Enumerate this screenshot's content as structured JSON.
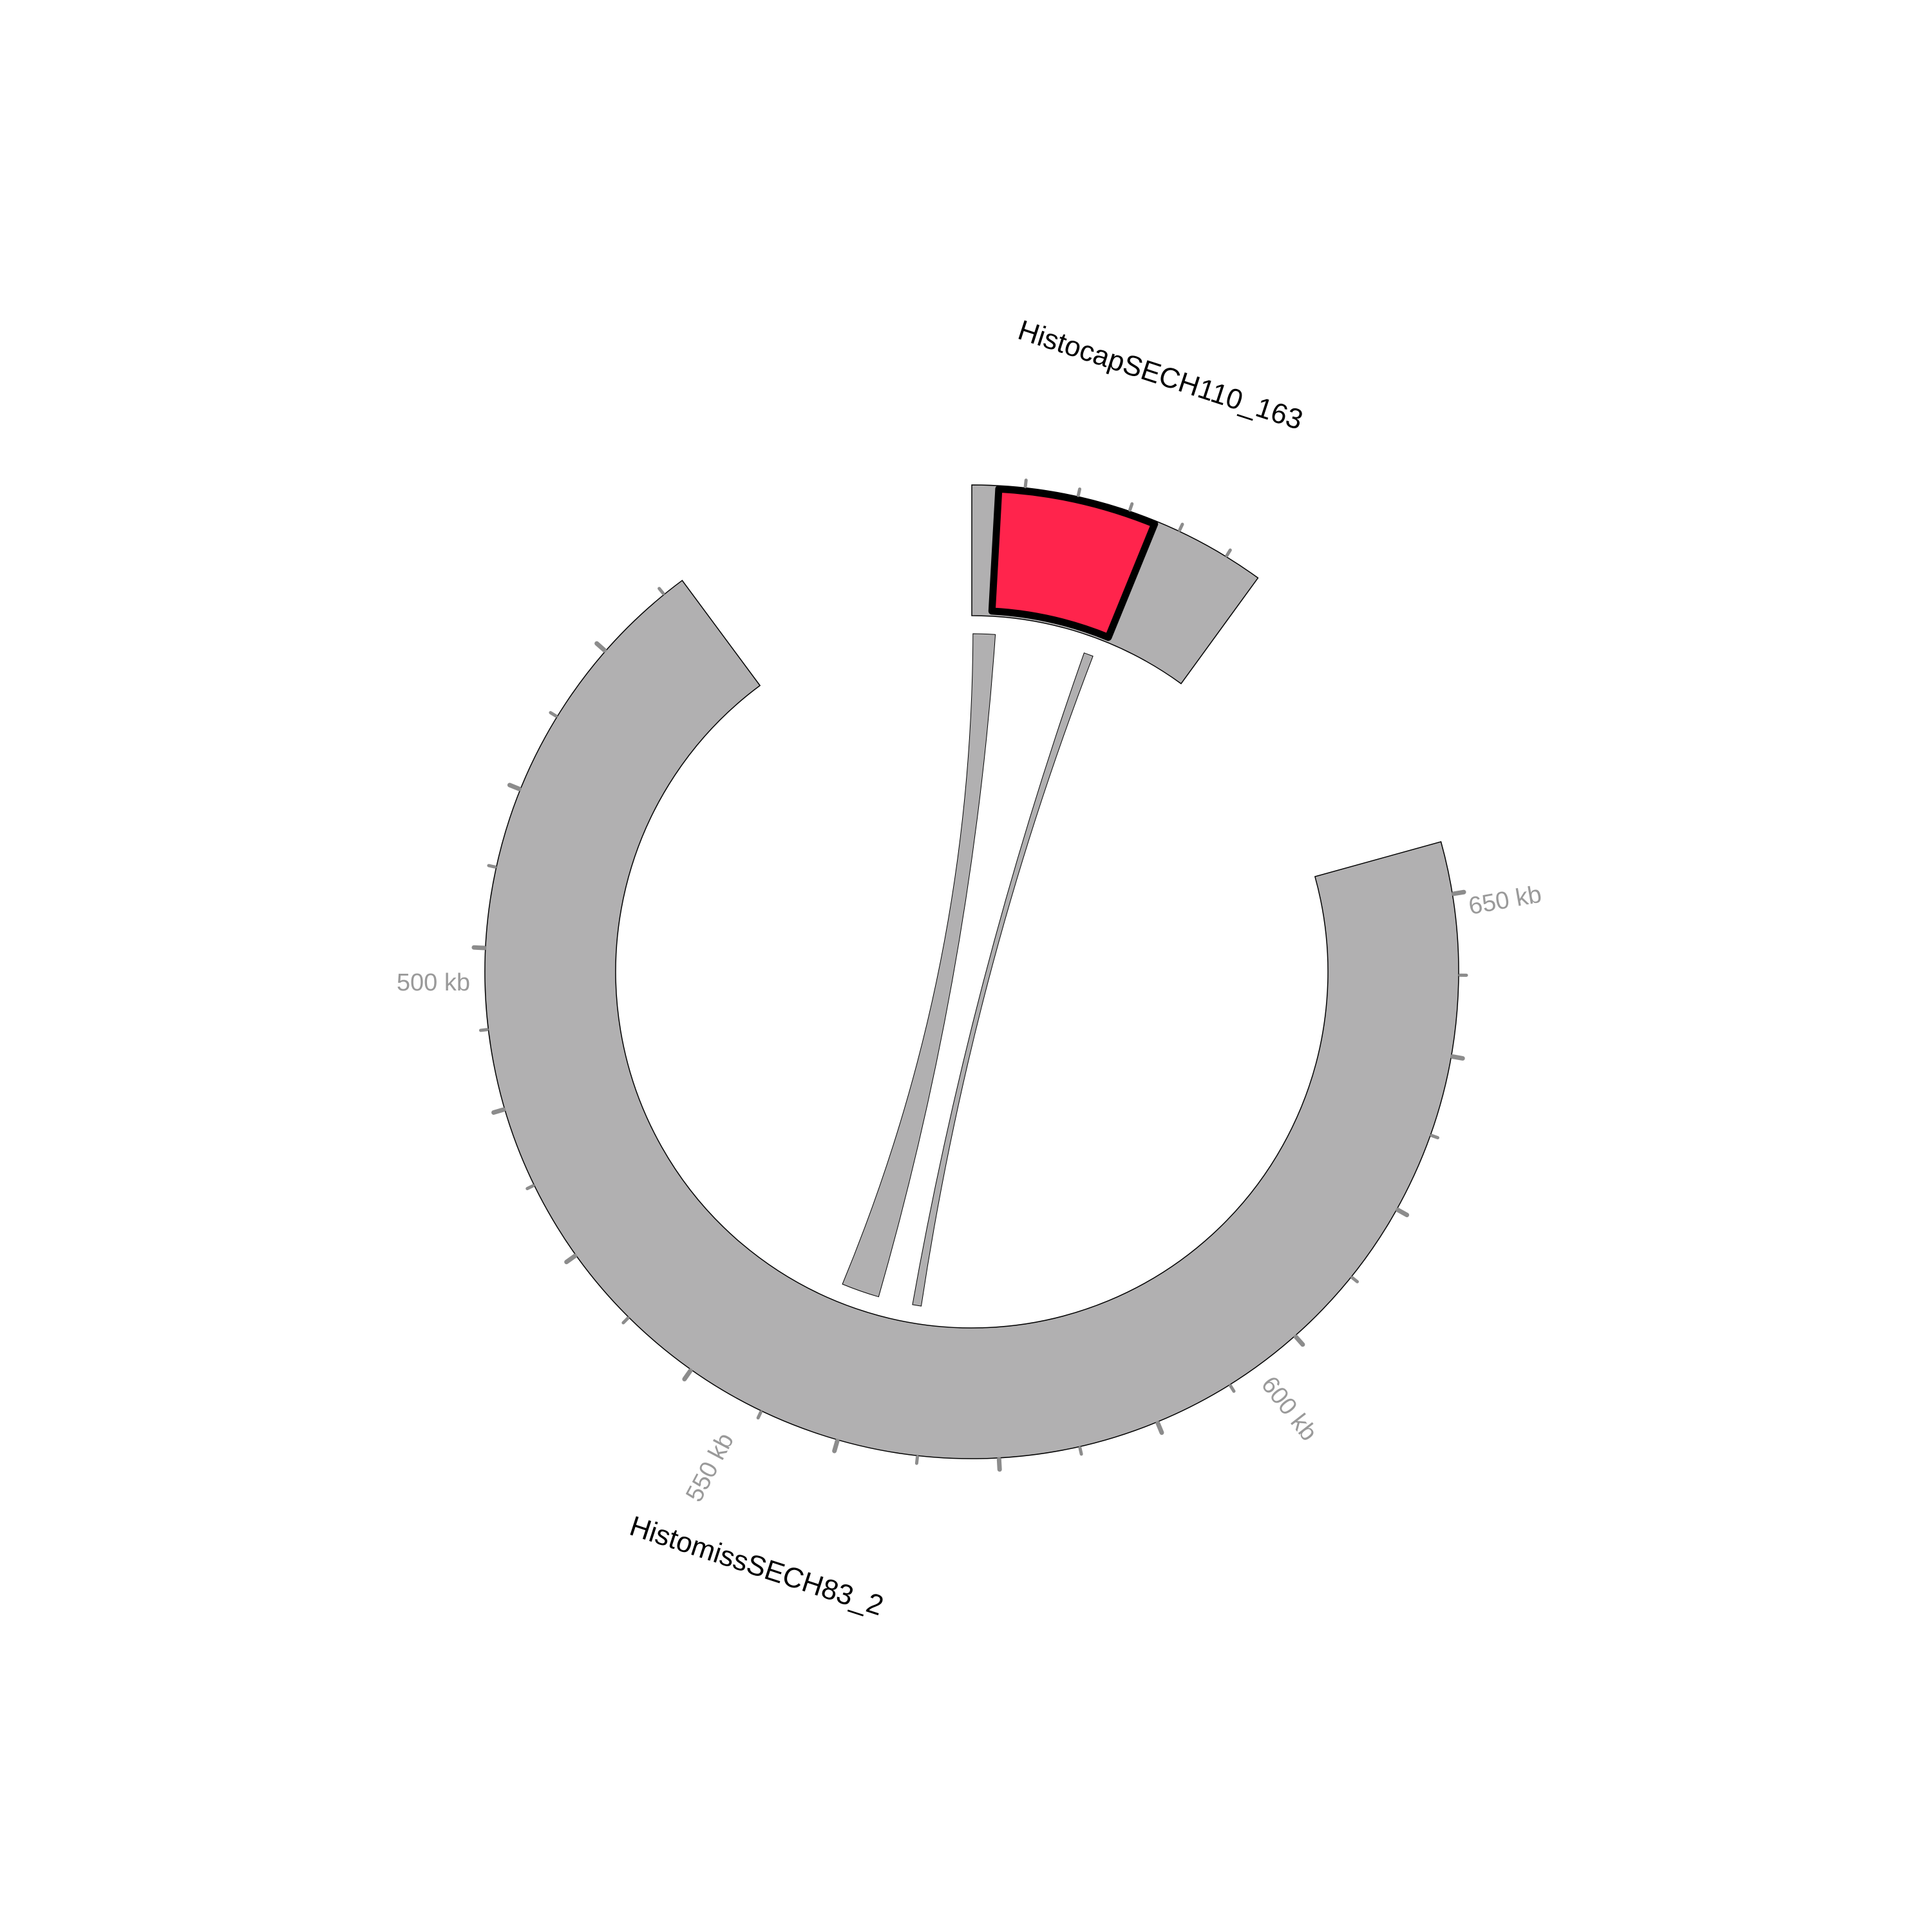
{
  "colors": {
    "background": "#ffffff",
    "segment_fill": "#b1b0b1",
    "segment_stroke": "#000000",
    "highlight_fill": "#ff244c",
    "highlight_stroke": "#000000",
    "link_fill": "#b1b0b1",
    "tick_color": "#8c8c8c",
    "tick_label_color": "#9a9a9a",
    "contig_label_color": "#000000"
  },
  "contigs": {
    "large": {
      "label": "HistomissSECH83_2"
    },
    "small": {
      "label": "HistocapSECH110_163"
    }
  },
  "tick_labels": {
    "t500": "500 kb",
    "t550": "550 kb",
    "t600": "600 kb",
    "t650": "650 kb"
  }
}
